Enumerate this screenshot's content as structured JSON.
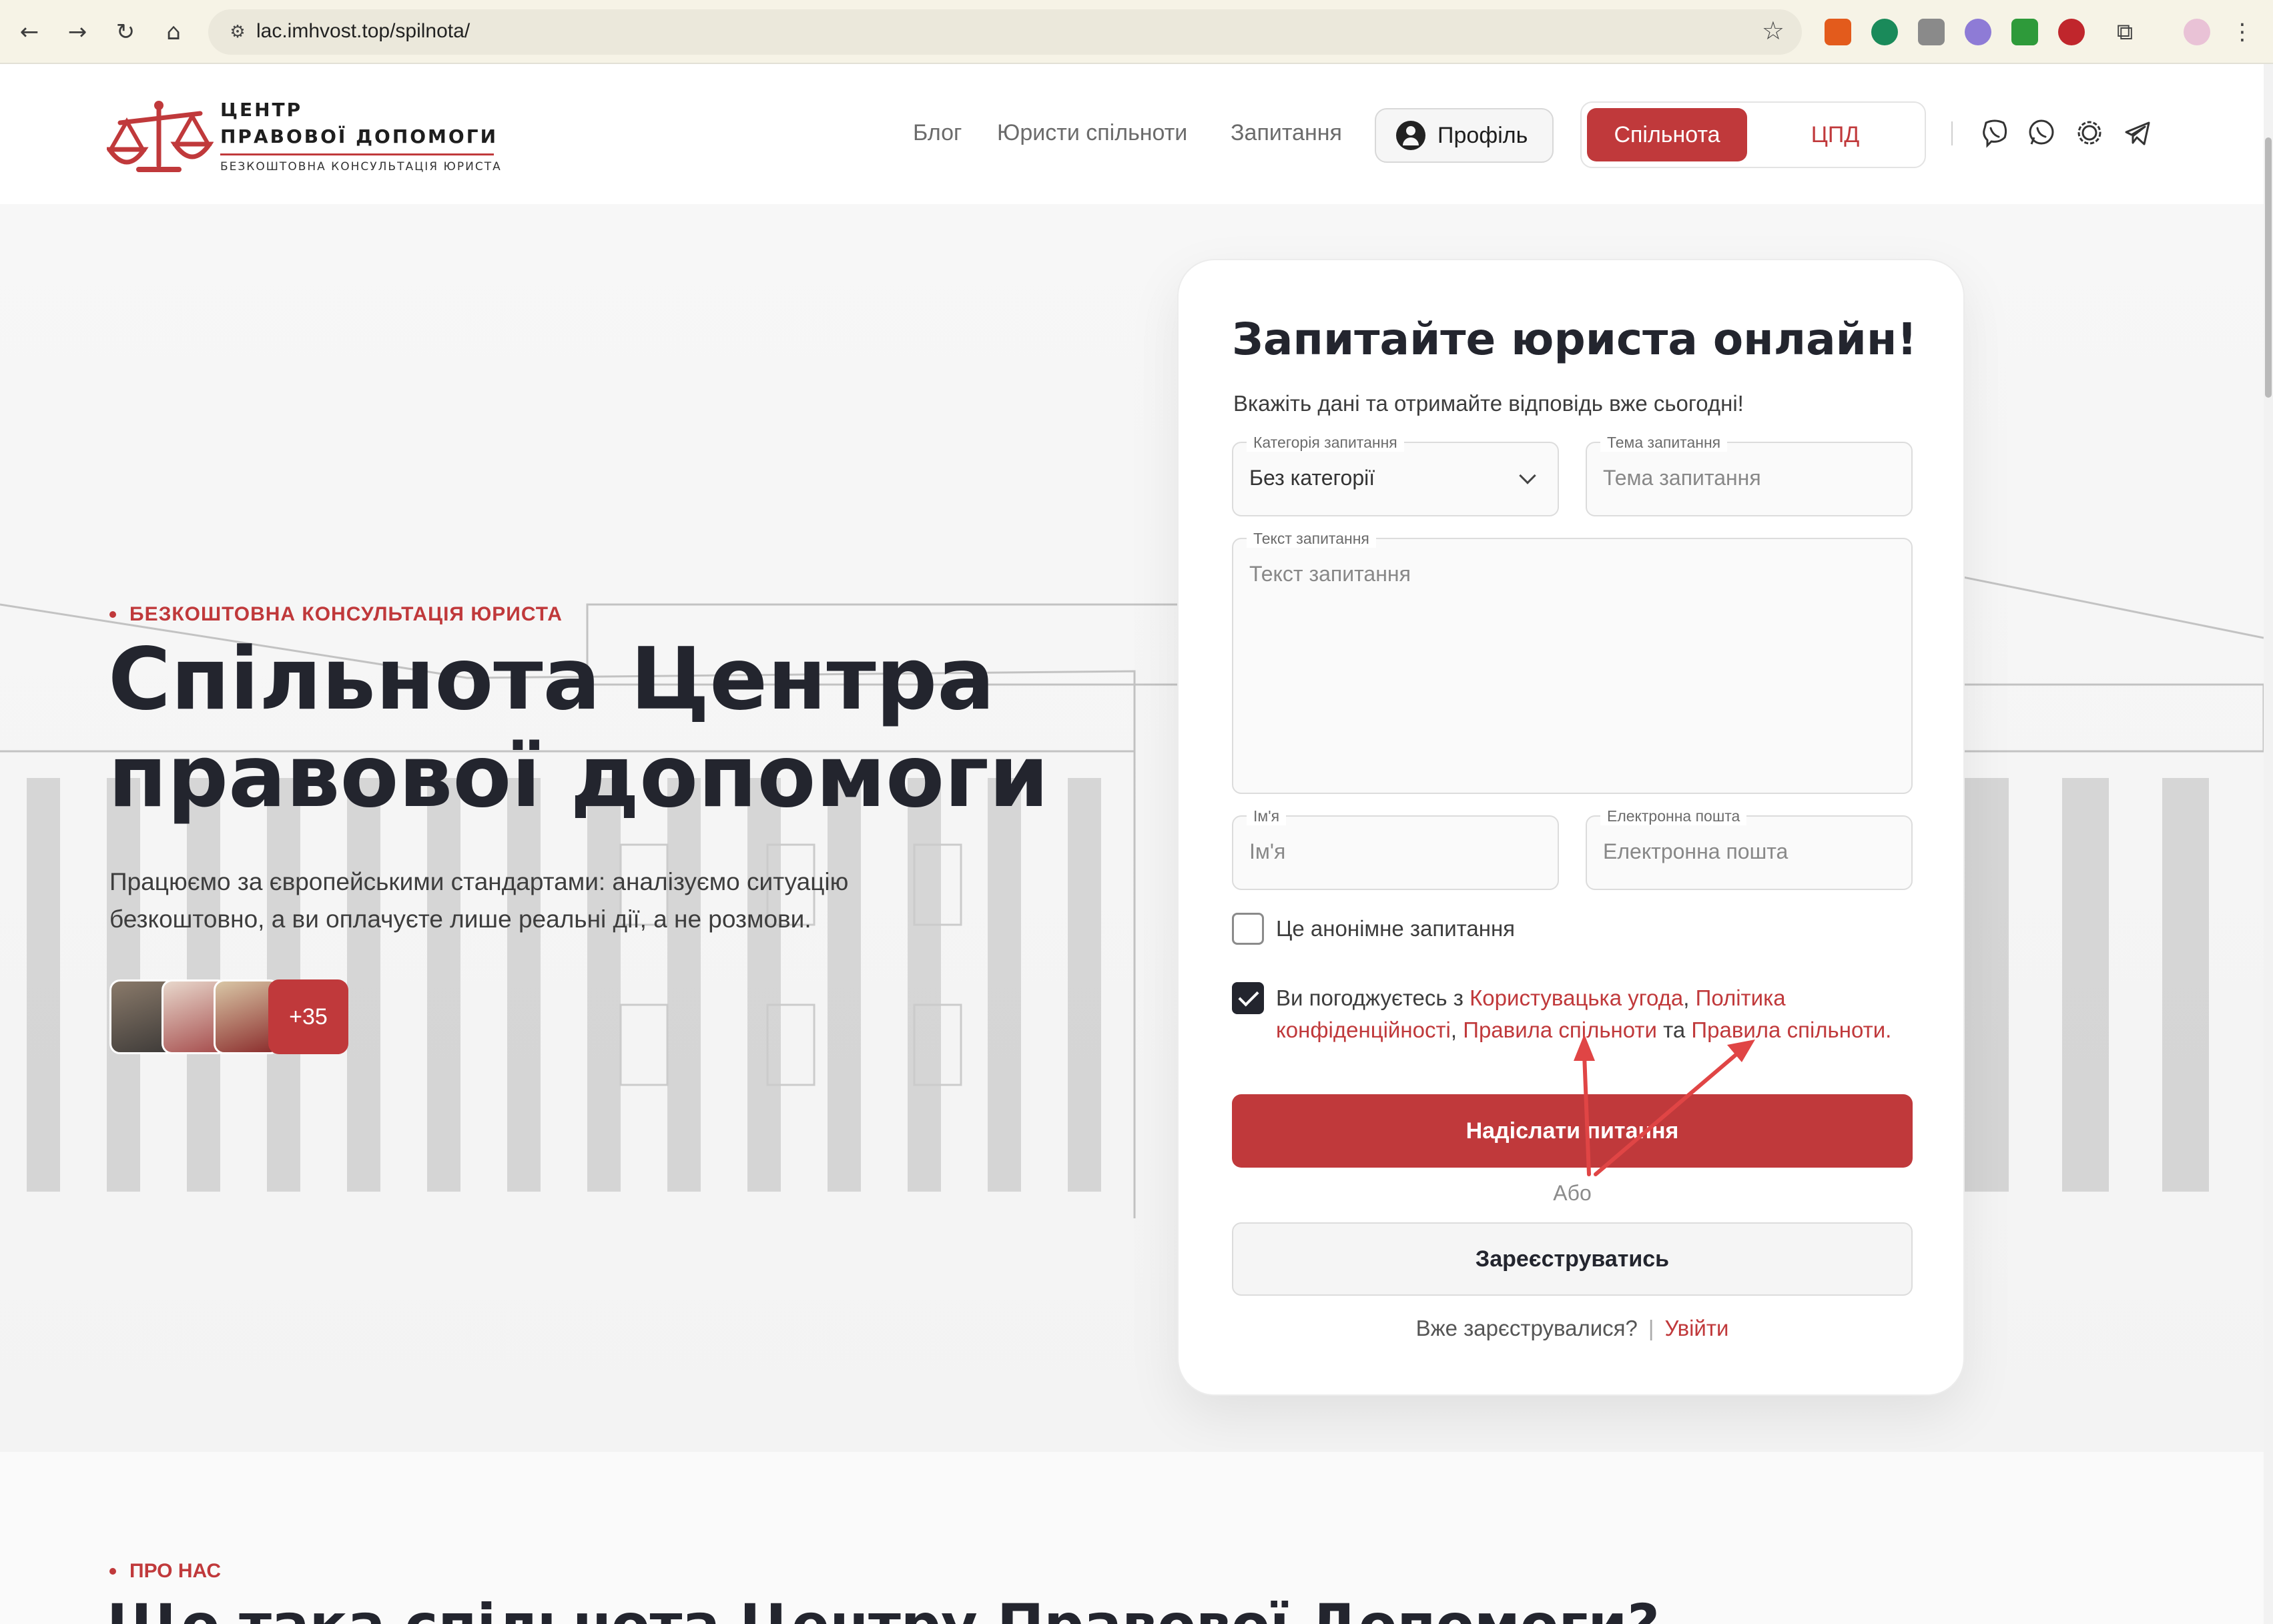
{
  "browser": {
    "url": "lac.imhvost.top/spilnota/"
  },
  "header": {
    "logo": {
      "line1": "ЦЕНТР",
      "line2": "ПРАВОВОЇ ДОПОМОГИ",
      "line3": "БЕЗКОШТОВНА КОНСУЛЬТАЦІЯ ЮРИСТА"
    },
    "menu": [
      "Блог",
      "Юристи спільноти",
      "Запитання"
    ],
    "profile_label": "Профіль",
    "toggle": {
      "active": "Спільнота",
      "inactive": "ЦПД"
    },
    "socials": [
      "viber-icon",
      "whatsapp-icon",
      "signal-icon",
      "telegram-icon"
    ]
  },
  "hero": {
    "eyebrow": "БЕЗКОШТОВНА КОНСУЛЬТАЦІЯ ЮРИСТА",
    "title": "Спільнота Центра правової допомоги",
    "text": "Працюємо за європейськими стандартами: аналізуємо ситуацію безкоштовно, а ви оплачуєте лише реальні дії, а не розмови.",
    "avatars_more": "+35"
  },
  "form": {
    "title": "Запитайте юриста онлайн!",
    "subtitle": "Вкажіть дані та отримайте відповідь вже сьогодні!",
    "category": {
      "label": "Категорія запитання",
      "value": "Без категорії"
    },
    "topic": {
      "label": "Тема запитання",
      "placeholder": "Тема запитання"
    },
    "question": {
      "label": "Текст запитання",
      "placeholder": "Текст запитання"
    },
    "name": {
      "label": "Ім'я",
      "placeholder": "Ім'я"
    },
    "email": {
      "label": "Електронна пошта",
      "placeholder": "Електронна пошта"
    },
    "anonymous_label": "Це анонімне запитання",
    "agree": {
      "prefix": "Ви погоджуєтесь з",
      "link1": "Користувацька угода",
      "comma1": ",",
      "link2": "Політика конфіденційності",
      "comma2": ",",
      "link3": "Правила спільноти",
      "and": "та",
      "link4": "Правила спільноти",
      "dot": "."
    },
    "submit_label": "Надіслати питання",
    "or_label": "Або",
    "register_label": "Зареєструватись",
    "already_label": "Вже зарєструвалися?",
    "separator": "|",
    "login_label": "Увійти"
  },
  "about": {
    "eyebrow": "ПРО НАС",
    "title": "Що така спільнота Центру Правової Допомоги?"
  },
  "colors": {
    "accent": "#c0393b",
    "dark": "#23252e"
  }
}
